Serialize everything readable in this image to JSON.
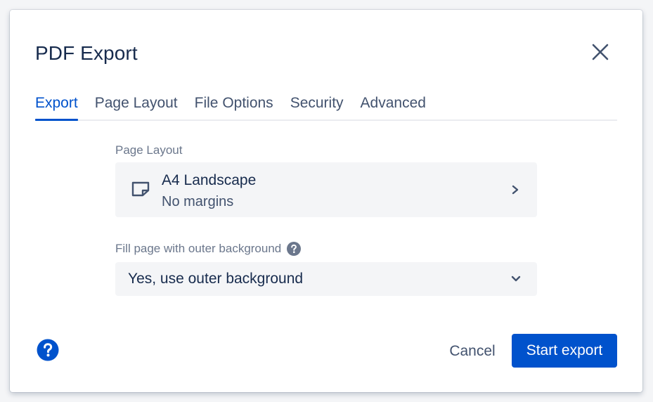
{
  "dialog": {
    "title": "PDF Export",
    "close_icon": "close-icon"
  },
  "tabs": [
    {
      "label": "Export",
      "active": true
    },
    {
      "label": "Page Layout",
      "active": false
    },
    {
      "label": "File Options",
      "active": false
    },
    {
      "label": "Security",
      "active": false
    },
    {
      "label": "Advanced",
      "active": false
    }
  ],
  "page_layout": {
    "label": "Page Layout",
    "icon": "page-icon",
    "value_title": "A4 Landscape",
    "value_subtitle": "No margins",
    "chevron_icon": "chevron-right-icon"
  },
  "fill_background": {
    "label": "Fill page with outer background",
    "help_icon": "question-circle-icon",
    "selected": "Yes, use outer background",
    "chevron_icon": "chevron-down-icon"
  },
  "footer": {
    "help_icon": "question-circle-icon",
    "cancel_label": "Cancel",
    "start_label": "Start export"
  },
  "colors": {
    "primary": "#0052cc",
    "text": "#172b4d",
    "subtle_text": "#42526e",
    "label": "#6b778c",
    "field_bg": "#f4f5f7",
    "divider": "#ebecf0"
  }
}
